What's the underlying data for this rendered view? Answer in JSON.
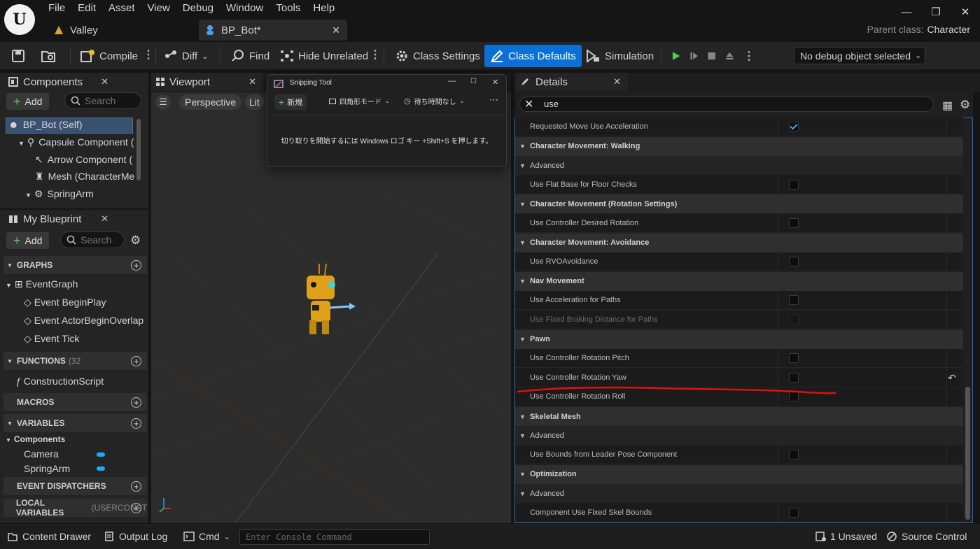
{
  "menu": [
    "File",
    "Edit",
    "Asset",
    "View",
    "Debug",
    "Window",
    "Tools",
    "Help"
  ],
  "tabs": {
    "valley": "Valley",
    "bpbot": "BP_Bot*"
  },
  "parent_class": {
    "label": "Parent class:",
    "value": "Character"
  },
  "toolbar": {
    "compile": "Compile",
    "diff": "Diff",
    "find": "Find",
    "hide_unrelated": "Hide Unrelated",
    "class_settings": "Class Settings",
    "class_defaults": "Class Defaults",
    "simulation": "Simulation",
    "debug_object": "No debug object selected"
  },
  "components": {
    "title": "Components",
    "add": "Add",
    "search_placeholder": "Search",
    "items": [
      "BP_Bot (Self)",
      "Capsule Component (",
      "Arrow Component (",
      "Mesh (CharacterMe",
      "SpringArm"
    ]
  },
  "blueprint": {
    "title": "My Blueprint",
    "add": "Add",
    "search_placeholder": "Search",
    "graphs": "GRAPHS",
    "eventgraph": "EventGraph",
    "events": [
      "Event BeginPlay",
      "Event ActorBeginOverlap",
      "Event Tick"
    ],
    "functions": "FUNCTIONS",
    "functions_count": "(32",
    "construction": "ConstructionScript",
    "macros": "MACROS",
    "variables": "VARIABLES",
    "components_cat": "Components",
    "vars": [
      "Camera",
      "SpringArm"
    ],
    "dispatchers": "EVENT DISPATCHERS",
    "local": "LOCAL VARIABLES",
    "local_suffix": "(USERCONST"
  },
  "viewport": {
    "title": "Viewport",
    "perspective": "Perspective",
    "lit": "Lit"
  },
  "snipping": {
    "title": "Snipping Tool",
    "new": "新規",
    "mode": "四角形モード",
    "delay": "待ち時間なし",
    "message": "切り取りを開始するには Windows ロゴ キー +Shift+S を押します。"
  },
  "details": {
    "title": "Details",
    "search_value": "use",
    "rows": [
      {
        "type": "prop",
        "label": "Requested Move Use Acceleration",
        "checked": true
      },
      {
        "type": "cat",
        "label": "Character Movement: Walking"
      },
      {
        "type": "sub",
        "label": "Advanced"
      },
      {
        "type": "prop",
        "label": "Use Flat Base for Floor Checks",
        "checked": false
      },
      {
        "type": "cat",
        "label": "Character Movement (Rotation Settings)"
      },
      {
        "type": "prop",
        "label": "Use Controller Desired Rotation",
        "checked": false
      },
      {
        "type": "cat",
        "label": "Character Movement: Avoidance"
      },
      {
        "type": "prop",
        "label": "Use RVOAvoidance",
        "checked": false
      },
      {
        "type": "cat",
        "label": "Nav Movement"
      },
      {
        "type": "prop",
        "label": "Use Acceleration for Paths",
        "checked": false
      },
      {
        "type": "prop",
        "label": "Use Fixed Braking Distance for Paths",
        "checked": false,
        "disabled": true
      },
      {
        "type": "cat",
        "label": "Pawn"
      },
      {
        "type": "prop",
        "label": "Use Controller Rotation Pitch",
        "checked": false
      },
      {
        "type": "prop",
        "label": "Use Controller Rotation Yaw",
        "checked": false,
        "reset": true
      },
      {
        "type": "prop",
        "label": "Use Controller Rotation Roll",
        "checked": false
      },
      {
        "type": "cat",
        "label": "Skeletal Mesh"
      },
      {
        "type": "sub",
        "label": "Advanced"
      },
      {
        "type": "prop",
        "label": "Use Bounds from Leader Pose Component",
        "checked": false
      },
      {
        "type": "cat",
        "label": "Optimization"
      },
      {
        "type": "sub",
        "label": "Advanced"
      },
      {
        "type": "prop",
        "label": "Component Use Fixed Skel Bounds",
        "checked": false
      }
    ]
  },
  "bottom": {
    "content_drawer": "Content Drawer",
    "output_log": "Output Log",
    "cmd": "Cmd",
    "console_placeholder": "Enter Console Command",
    "unsaved": "1 Unsaved",
    "source_control": "Source Control"
  },
  "colors": {
    "accent": "#0a6fd6",
    "annotation": "#e01010",
    "checkbox_check": "#3fa1ff"
  }
}
